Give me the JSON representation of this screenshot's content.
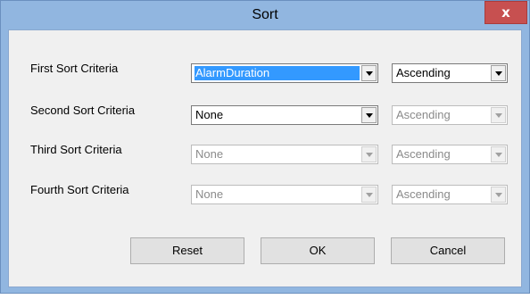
{
  "window": {
    "title": "Sort",
    "close_glyph": "x"
  },
  "criteria": [
    {
      "label": "First Sort Criteria",
      "field": "AlarmDuration",
      "order": "Ascending"
    },
    {
      "label": "Second Sort Criteria",
      "field": "None",
      "order": "Ascending"
    },
    {
      "label": "Third Sort Criteria",
      "field": "None",
      "order": "Ascending"
    },
    {
      "label": "Fourth Sort Criteria",
      "field": "None",
      "order": "Ascending"
    }
  ],
  "buttons": {
    "reset": "Reset",
    "ok": "OK",
    "cancel": "Cancel"
  },
  "colors": {
    "title_bar": "#91b6e0",
    "close_button": "#c75050",
    "selection": "#3399ff"
  }
}
